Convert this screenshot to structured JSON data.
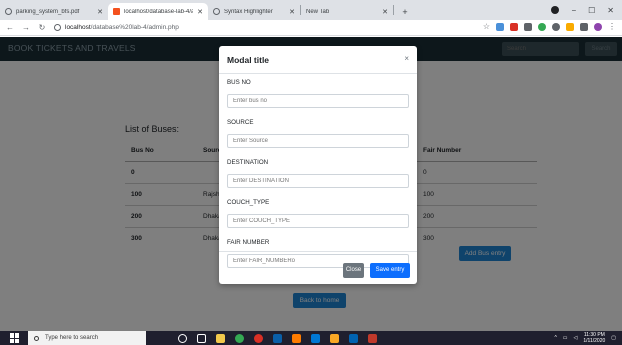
{
  "browser": {
    "tabs": [
      {
        "label": "parking_system_bfs.pdf",
        "active": false
      },
      {
        "label": "localhost/database-lab-4/admin...",
        "active": true
      },
      {
        "label": "Syntax Highlighter",
        "active": false
      },
      {
        "label": "New Tab",
        "active": false
      }
    ],
    "url_host": "localhost",
    "url_path": "/database%20lab-4/admin.php"
  },
  "navbar": {
    "brand": "BOOK TICKETS AND TRAVELS",
    "search_placeholder": "Search",
    "search_button": "Search"
  },
  "page": {
    "list_title": "List of Buses:",
    "table": {
      "headers": [
        "Bus No",
        "Source",
        "",
        "Fair Number"
      ],
      "rows": [
        [
          "0",
          "",
          "",
          "0"
        ],
        [
          "100",
          "Rajshahi",
          "",
          "100"
        ],
        [
          "200",
          "Dhaka",
          "",
          "200"
        ],
        [
          "300",
          "Dhaka",
          "",
          "300"
        ]
      ]
    },
    "add_bus_button": "Add Bus entry",
    "back_home_button": "Back to home"
  },
  "modal": {
    "title": "Modal title",
    "close_symbol": "×",
    "fields": [
      {
        "label": "BUS NO",
        "placeholder": "Enter bus no"
      },
      {
        "label": "SOURCE",
        "placeholder": "Enter Source"
      },
      {
        "label": "DESTINATION",
        "placeholder": "Enter DESTINATION"
      },
      {
        "label": "COUCH_TYPE",
        "placeholder": "Enter COUCH_TYPE"
      },
      {
        "label": "FAIR NUMBER",
        "placeholder": "Enter FAIR_NUMBERo"
      }
    ],
    "close_button": "Close",
    "save_button": "Save entry"
  },
  "taskbar": {
    "search_placeholder": "Type here to search",
    "time": "11:30 PM",
    "date": "1/11/2020"
  },
  "colors": {
    "navbar": "#1a2e37",
    "primary": "#0d6efd",
    "secondary": "#6c757d"
  }
}
